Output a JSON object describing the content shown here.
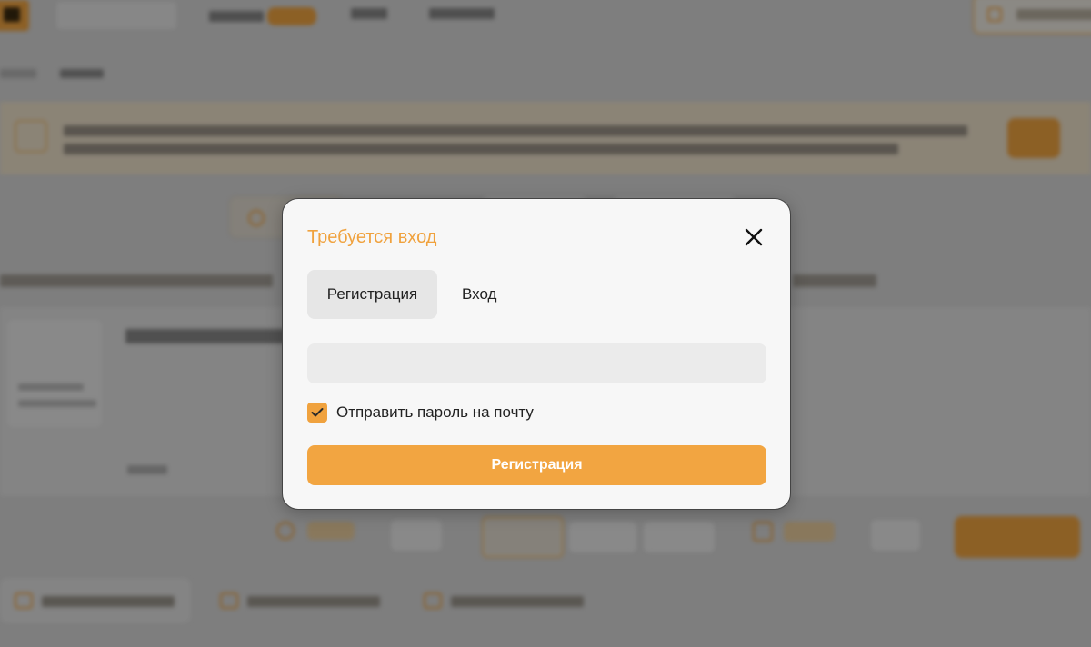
{
  "modal": {
    "title": "Требуется вход",
    "tabs": [
      {
        "label": "Регистрация",
        "active": true
      },
      {
        "label": "Вход",
        "active": false
      }
    ],
    "email_placeholder": "",
    "email_value": "",
    "send_password_checkbox": {
      "label": "Отправить пароль на почту",
      "checked": true
    },
    "submit_label": "Регистрация"
  },
  "colors": {
    "accent": "#f2a541",
    "title": "#f0a23e",
    "overlay": "rgba(0,0,0,0.42)"
  },
  "icons": {
    "close": "close-icon",
    "check": "check-icon"
  }
}
